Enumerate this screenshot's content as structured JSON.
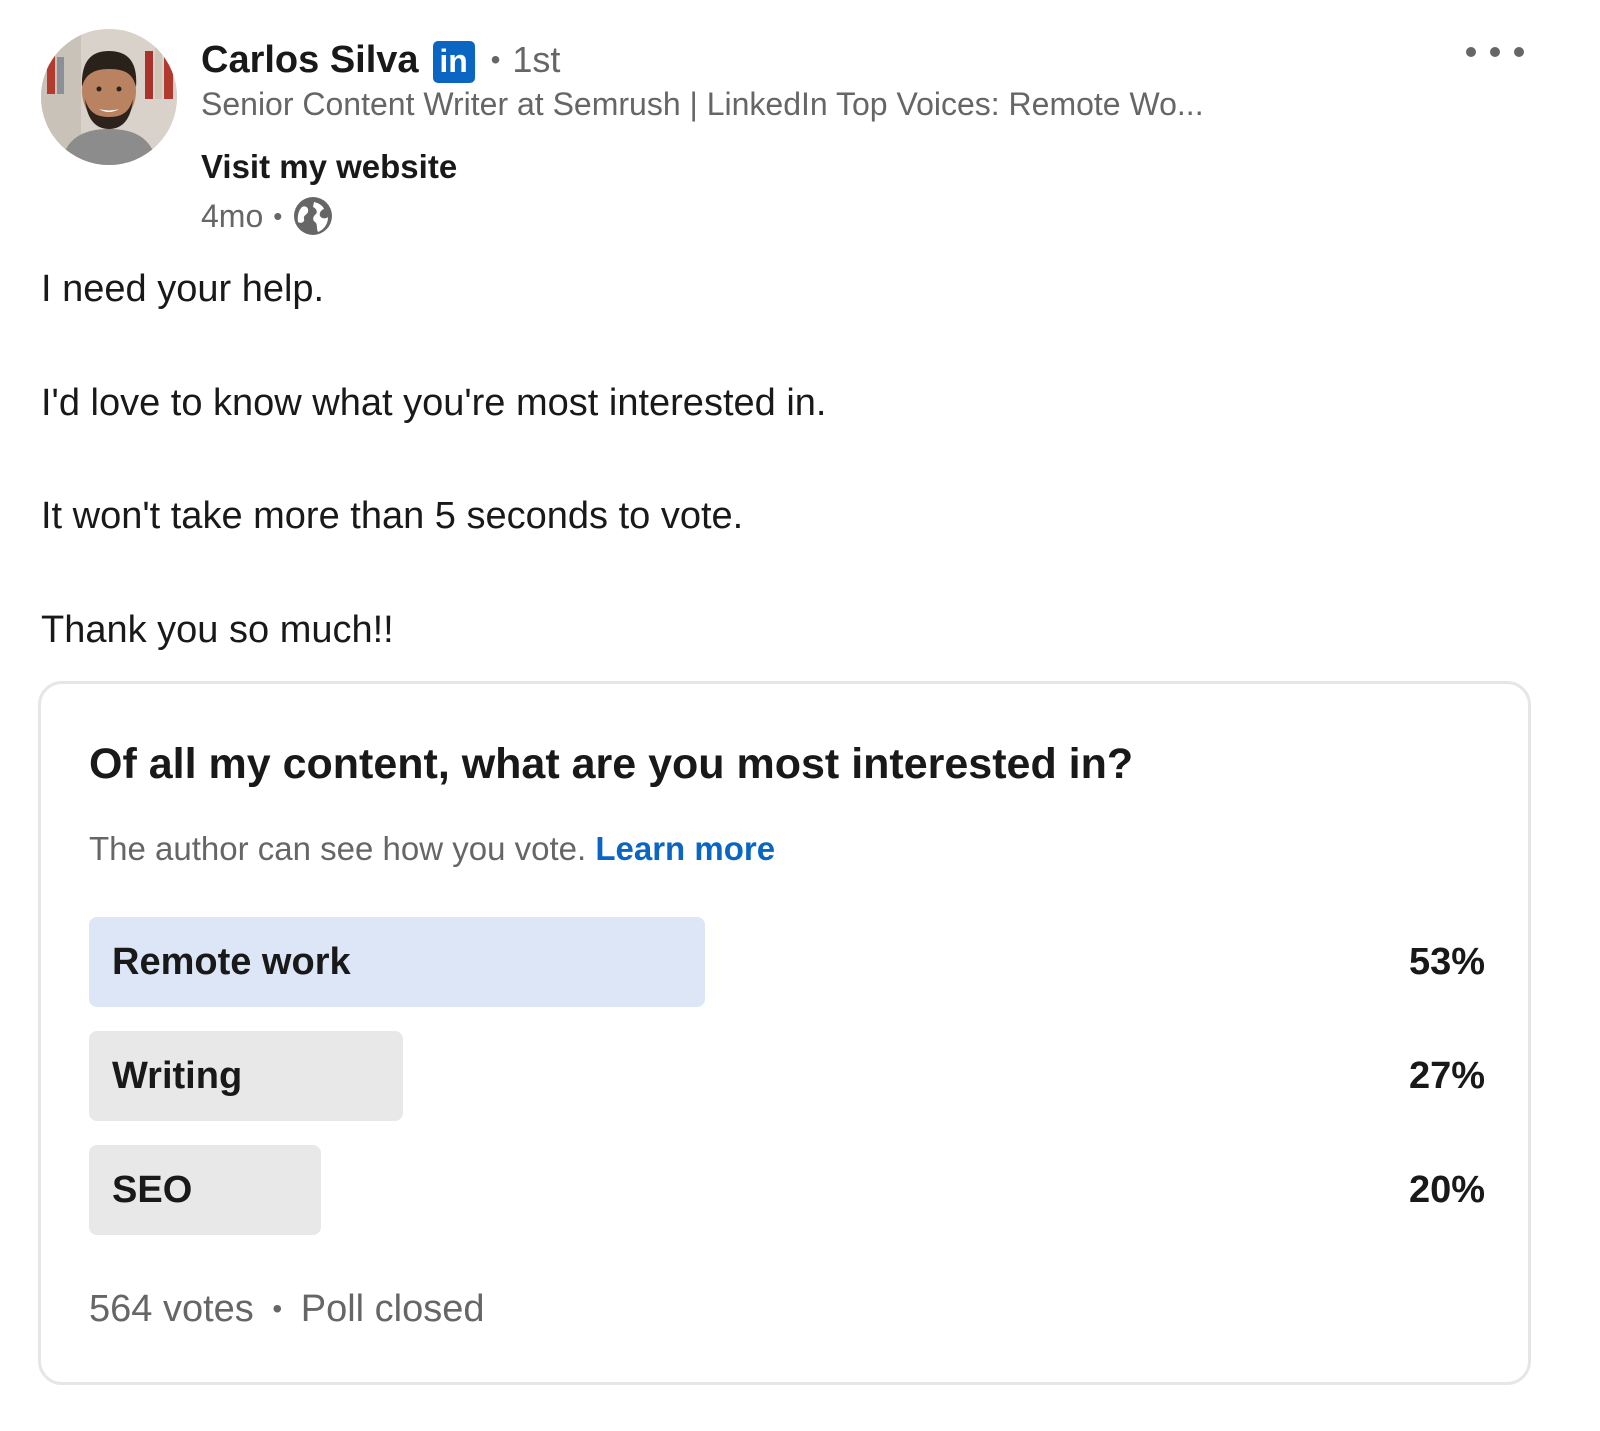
{
  "author": {
    "name": "Carlos Silva",
    "badge_text": "in",
    "separator": "•",
    "degree": "1st",
    "headline": "Senior Content Writer at Semrush | LinkedIn Top Voices: Remote Wo...",
    "website_link": "Visit my website",
    "time": "4mo",
    "visibility_icon": "globe-icon"
  },
  "menu": {
    "icon": "more-options-icon"
  },
  "post": {
    "lines": [
      "I need your help.",
      "I'd love to know what you're most interested in.",
      "It won't take more than 5 seconds to vote.",
      "Thank you so much!!"
    ]
  },
  "poll": {
    "question": "Of all my content, what are you most interested in?",
    "notice": "The author can see how you vote.",
    "learn_more": "Learn more",
    "options": [
      {
        "label": "Remote work",
        "percent": 53,
        "percent_text": "53%"
      },
      {
        "label": "Writing",
        "percent": 27,
        "percent_text": "27%"
      },
      {
        "label": "SEO",
        "percent": 20,
        "percent_text": "20%"
      }
    ],
    "votes": "564 votes",
    "separator": "•",
    "status": "Poll closed"
  },
  "colors": {
    "brand_blue": "#0a66c2",
    "leading_option_fill": "#dce6f7",
    "option_fill": "#e8e8e8",
    "secondary_text": "#666666"
  }
}
